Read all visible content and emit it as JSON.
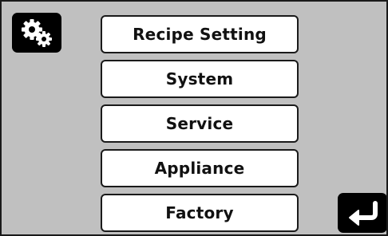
{
  "toolbar": {
    "settings_icon": "gears-icon",
    "back_icon": "return-arrow-icon"
  },
  "menu": {
    "items": [
      {
        "label": "Recipe Setting"
      },
      {
        "label": "System"
      },
      {
        "label": "Service"
      },
      {
        "label": "Appliance"
      },
      {
        "label": "Factory"
      }
    ]
  },
  "colors": {
    "background": "#c0c0c0",
    "button_fill": "#ffffff",
    "border": "#1a1a1a",
    "icon_button": "#000000"
  }
}
